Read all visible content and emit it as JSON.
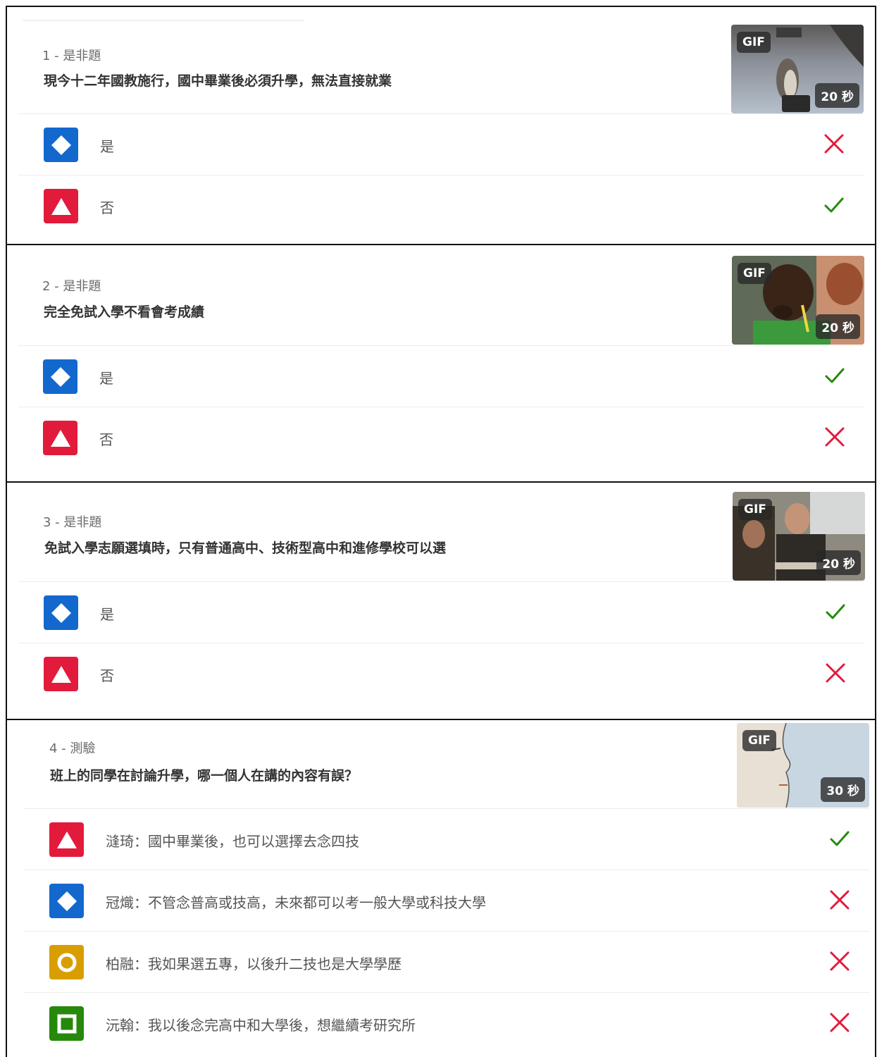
{
  "questions": [
    {
      "meta": "1 - 是非題",
      "text": "現今十二年國教施行，國中畢業後必須升學，無法直接就業",
      "media": {
        "gif_label": "GIF",
        "time_label": "20 秒",
        "icon": "penguin-gif-image"
      },
      "answers": [
        {
          "shape": "diamond",
          "color": "#1368ce",
          "text": "是",
          "correct": false
        },
        {
          "shape": "triangle",
          "color": "#e21b3c",
          "text": "否",
          "correct": true
        }
      ]
    },
    {
      "meta": "2 - 是非題",
      "text": "完全免試入學不看會考成績",
      "media": {
        "gif_label": "GIF",
        "time_label": "20 秒",
        "icon": "kid-writing-gif-image"
      },
      "answers": [
        {
          "shape": "diamond",
          "color": "#1368ce",
          "text": "是",
          "correct": true
        },
        {
          "shape": "triangle",
          "color": "#e21b3c",
          "text": "否",
          "correct": false
        }
      ]
    },
    {
      "meta": "3 - 是非題",
      "text": "免試入學志願選填時，只有普通高中、技術型高中和進修學校可以選",
      "media": {
        "gif_label": "GIF",
        "time_label": "20 秒",
        "icon": "classroom-gif-image"
      },
      "answers": [
        {
          "shape": "diamond",
          "color": "#1368ce",
          "text": "是",
          "correct": true
        },
        {
          "shape": "triangle",
          "color": "#e21b3c",
          "text": "否",
          "correct": false
        }
      ]
    },
    {
      "meta": "4 - 測驗",
      "text": "班上的同學在討論升學，哪一個人在講的內容有誤？",
      "media": {
        "gif_label": "GIF",
        "time_label": "30 秒",
        "icon": "face-sketch-gif-image"
      },
      "answers": [
        {
          "shape": "triangle",
          "color": "#e21b3c",
          "text": "漨琦：國中畢業後，也可以選擇去念四技",
          "correct": true
        },
        {
          "shape": "diamond",
          "color": "#1368ce",
          "text": "冠熾：不管念普高或技高，未來都可以考一般大學或科技大學",
          "correct": false
        },
        {
          "shape": "circle",
          "color": "#d89e00",
          "text": "柏融：我如果選五專，以後升二技也是大學學歷",
          "correct": false
        },
        {
          "shape": "square",
          "color": "#26890c",
          "text": "沅翰：我以後念完高中和大學後，想繼續考研究所",
          "correct": false
        }
      ]
    }
  ],
  "colors": {
    "correct": "#26890c",
    "incorrect": "#e21b3c"
  }
}
